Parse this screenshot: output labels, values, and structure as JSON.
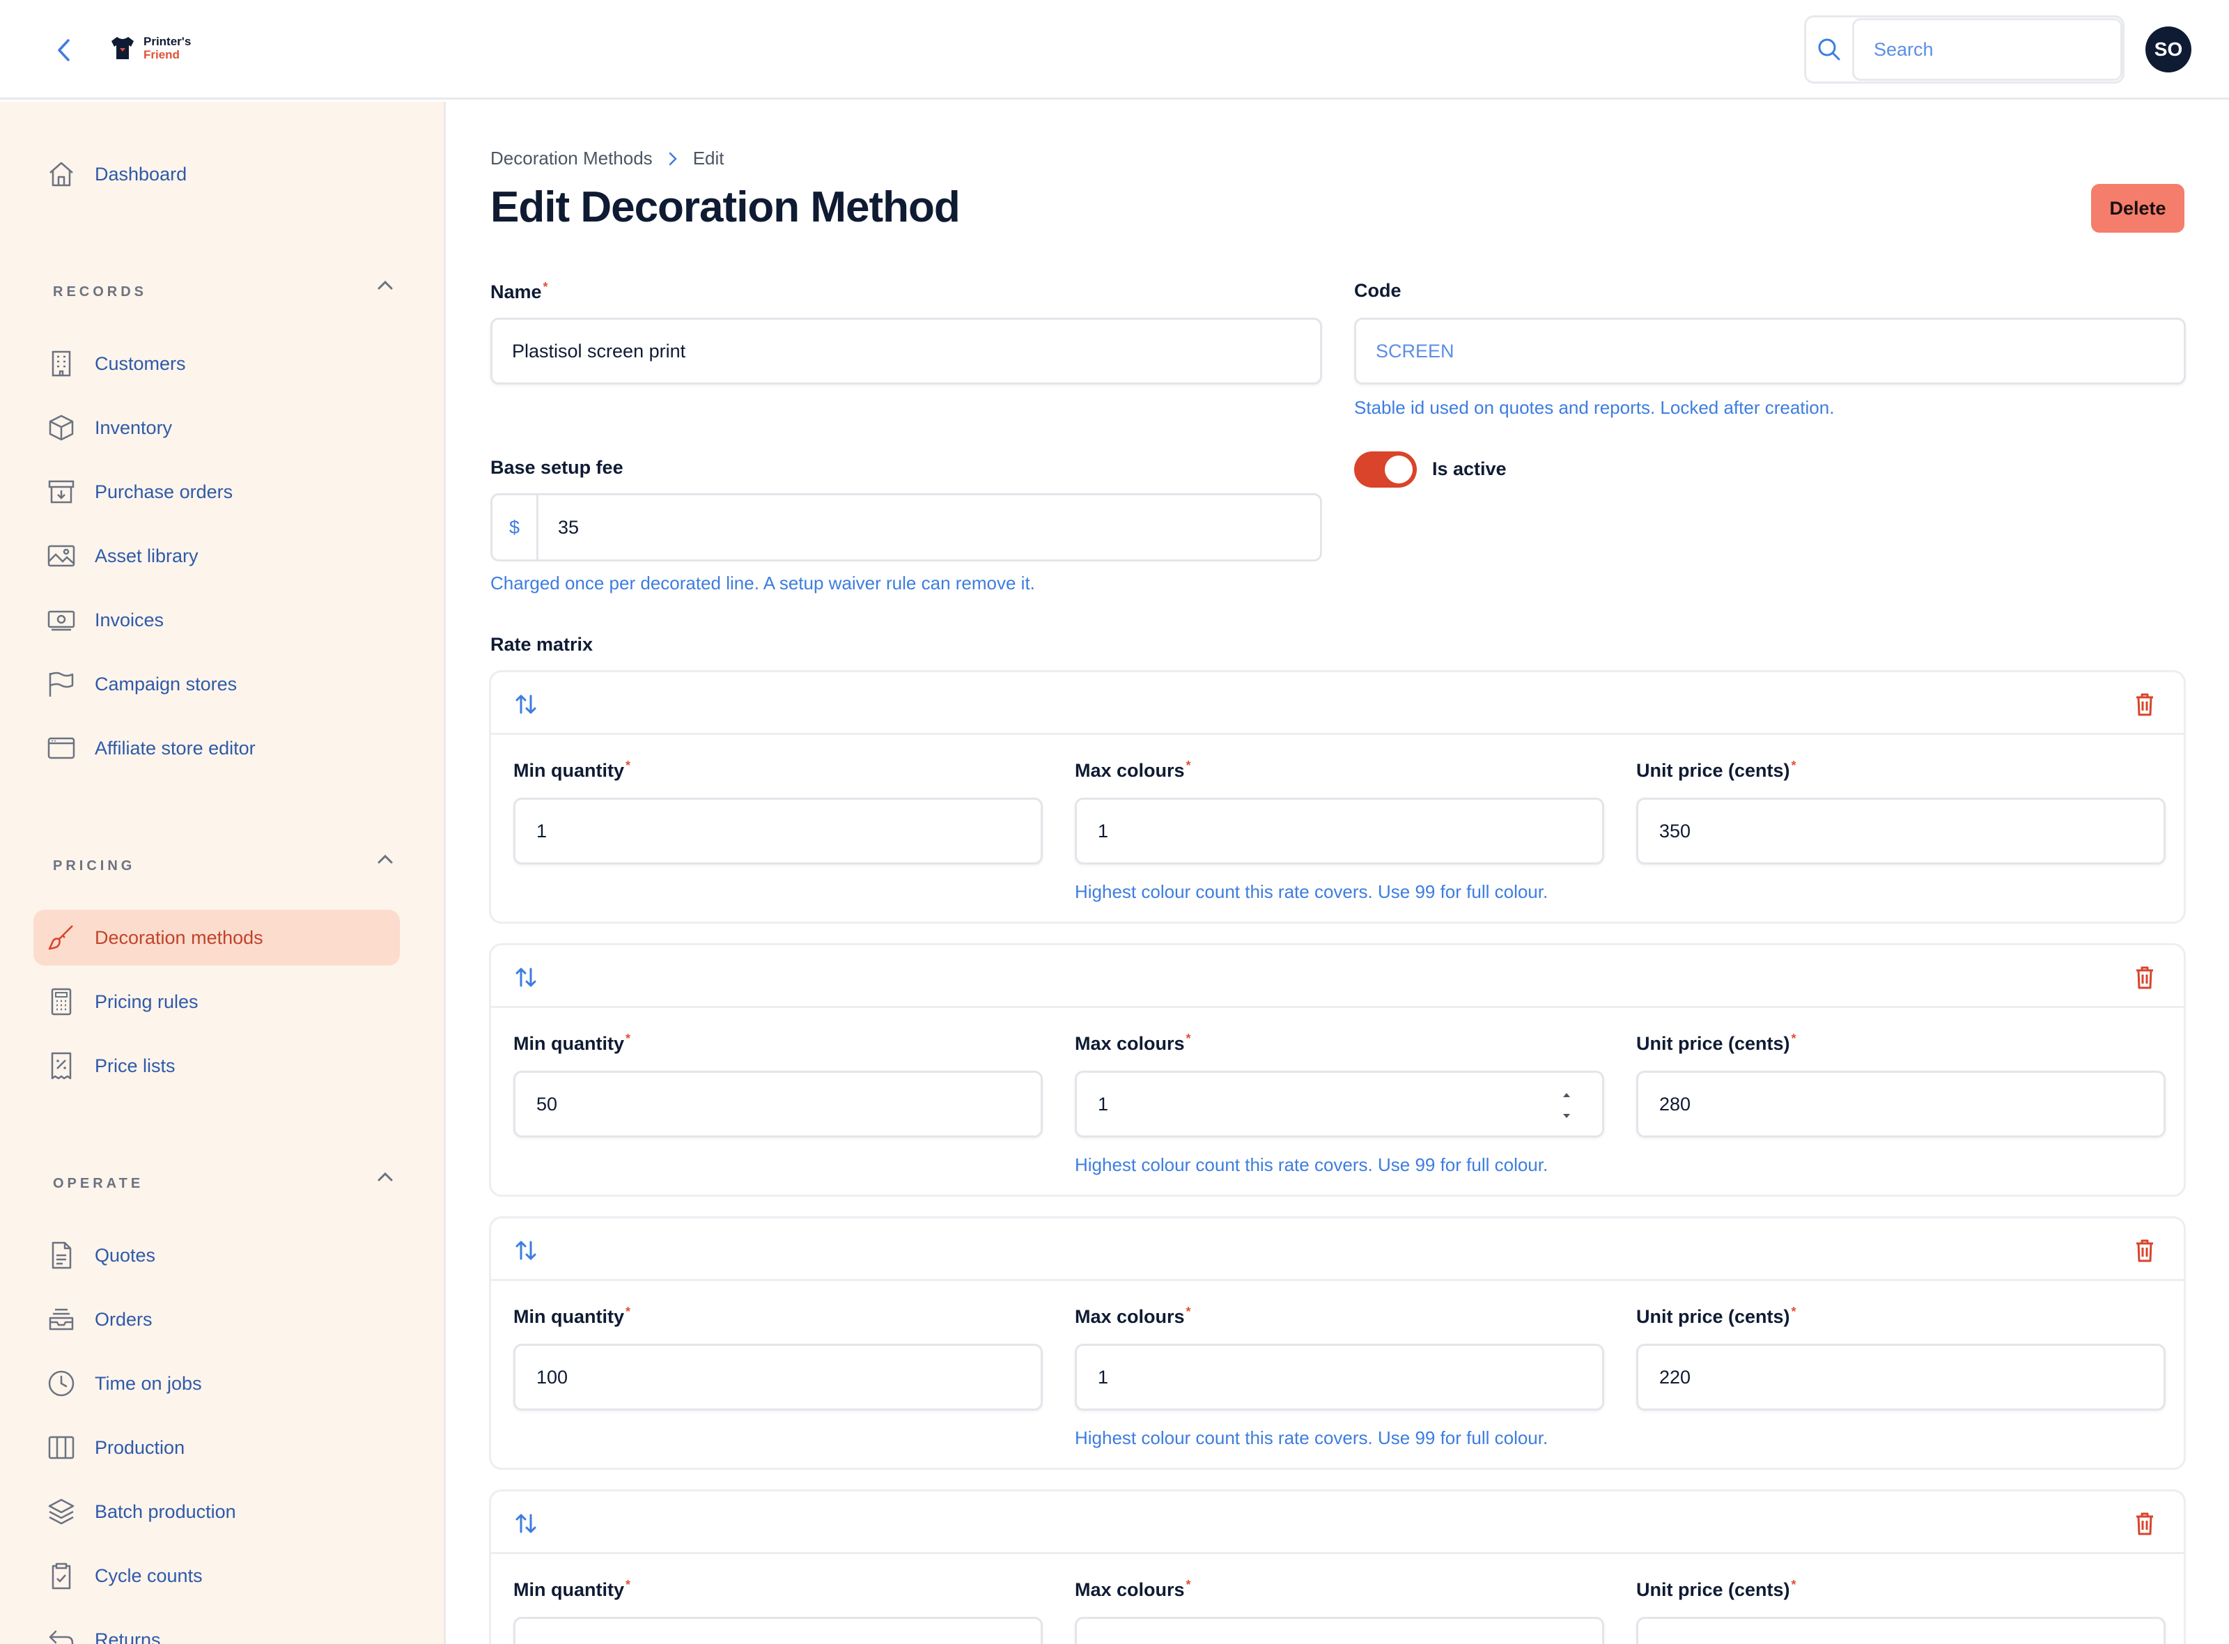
{
  "app": {
    "brand_line1": "Printer's",
    "brand_line2": "Friend",
    "user_initials": "SO"
  },
  "search": {
    "placeholder": "Search"
  },
  "sidebar": {
    "top": [
      {
        "label": "Dashboard",
        "icon": "home-icon"
      }
    ],
    "sections": [
      {
        "title": "RECORDS",
        "items": [
          {
            "label": "Customers",
            "icon": "building-icon"
          },
          {
            "label": "Inventory",
            "icon": "cube-icon"
          },
          {
            "label": "Purchase orders",
            "icon": "archive-download-icon"
          },
          {
            "label": "Asset library",
            "icon": "image-icon"
          },
          {
            "label": "Invoices",
            "icon": "banknote-icon"
          },
          {
            "label": "Campaign stores",
            "icon": "flag-icon"
          },
          {
            "label": "Affiliate store editor",
            "icon": "browser-window-icon"
          }
        ]
      },
      {
        "title": "PRICING",
        "items": [
          {
            "label": "Decoration methods",
            "icon": "paintbrush-icon",
            "active": true
          },
          {
            "label": "Pricing rules",
            "icon": "calculator-icon"
          },
          {
            "label": "Price lists",
            "icon": "receipt-percent-icon"
          }
        ]
      },
      {
        "title": "OPERATE",
        "items": [
          {
            "label": "Quotes",
            "icon": "document-text-icon"
          },
          {
            "label": "Orders",
            "icon": "inbox-stack-icon"
          },
          {
            "label": "Time on jobs",
            "icon": "clock-icon"
          },
          {
            "label": "Production",
            "icon": "columns-icon"
          },
          {
            "label": "Batch production",
            "icon": "layers-icon"
          },
          {
            "label": "Cycle counts",
            "icon": "clipboard-check-icon"
          },
          {
            "label": "Returns",
            "icon": "return-arrow-icon"
          }
        ]
      }
    ]
  },
  "breadcrumb": {
    "parent": "Decoration Methods",
    "current": "Edit"
  },
  "page": {
    "title": "Edit Decoration Method",
    "delete_label": "Delete"
  },
  "form": {
    "name": {
      "label": "Name",
      "value": "Plastisol screen print"
    },
    "code": {
      "label": "Code",
      "value": "SCREEN",
      "hint": "Stable id used on quotes and reports. Locked after creation."
    },
    "setup_fee": {
      "label": "Base setup fee",
      "prefix": "$",
      "value": "35",
      "hint": "Charged once per decorated line. A setup waiver rule can remove it."
    },
    "is_active": {
      "label": "Is active",
      "value": true
    },
    "rate_matrix": {
      "label": "Rate matrix",
      "min_qty_label": "Min quantity",
      "max_colours_label": "Max colours",
      "unit_price_label": "Unit price (cents)",
      "max_colours_hint": "Highest colour count this rate covers. Use 99 for full colour.",
      "rows": [
        {
          "min_quantity": "1",
          "max_colours": "1",
          "unit_price": "350"
        },
        {
          "min_quantity": "50",
          "max_colours": "1",
          "unit_price": "280"
        },
        {
          "min_quantity": "100",
          "max_colours": "1",
          "unit_price": "220"
        },
        {
          "min_quantity": "",
          "max_colours": "",
          "unit_price": ""
        }
      ]
    }
  },
  "colors": {
    "accent": "#d9442b",
    "link": "#2e5aa8",
    "hint": "#3d7de0",
    "sidebar_bg": "#fdf4ec",
    "active_bg": "#fbdccd",
    "delete_bg": "#f47d6b"
  }
}
